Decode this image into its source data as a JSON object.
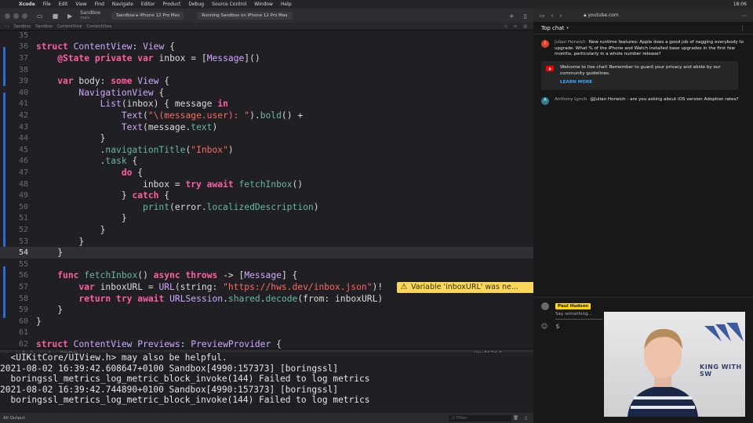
{
  "menubar": {
    "app_name": "Xcode",
    "items": [
      "File",
      "Edit",
      "View",
      "Find",
      "Navigate",
      "Editor",
      "Product",
      "Debug",
      "Source Control",
      "Window",
      "Help"
    ],
    "clock": "18:06"
  },
  "xcode": {
    "scheme_name": "Sandbox",
    "scheme_branch": "main",
    "tab_label": "Sandbox",
    "device": "iPhone 12 Pro Max",
    "status": "Running Sandbox on iPhone 12 Pro Max",
    "jumpbar": [
      "Sandbox",
      "Sandbox",
      "ContentView",
      "ContentView"
    ],
    "warning_text": "Variable 'inboxURL' was ne...",
    "debug_process": "Sandbox",
    "cursor_position": "Line: 54  Col: 6",
    "output_scope": "All Output",
    "filter_placeholder": "Filter",
    "console_lines": [
      "  <UIKitCore/UIView.h> may also be helpful.",
      "2021-08-02 16:39:42.608647+0100 Sandbox[4990:157373] [boringssl]",
      "  boringssl_metrics_log_metric_block_invoke(144) Failed to log metrics",
      "2021-08-02 16:39:42.744890+0100 Sandbox[4990:157373] [boringssl]",
      "  boringssl_metrics_log_metric_block_invoke(144) Failed to log metrics"
    ],
    "code_lines": [
      {
        "n": "35",
        "tokens": []
      },
      {
        "n": "36",
        "tokens": [
          [
            "kw",
            "struct"
          ],
          [
            "p",
            " "
          ],
          [
            "ty",
            "ContentView"
          ],
          [
            "p",
            ": "
          ],
          [
            "ty",
            "View"
          ],
          [
            "p",
            " {"
          ]
        ]
      },
      {
        "n": "37",
        "tokens": [
          [
            "p",
            "    "
          ],
          [
            "kw",
            "@State"
          ],
          [
            "p",
            " "
          ],
          [
            "kw",
            "private"
          ],
          [
            "p",
            " "
          ],
          [
            "kw",
            "var"
          ],
          [
            "p",
            " inbox = ["
          ],
          [
            "ty",
            "Message"
          ],
          [
            "p",
            "]()"
          ]
        ]
      },
      {
        "n": "38",
        "tokens": []
      },
      {
        "n": "39",
        "tokens": [
          [
            "p",
            "    "
          ],
          [
            "kw",
            "var"
          ],
          [
            "p",
            " body: "
          ],
          [
            "kw",
            "some"
          ],
          [
            "p",
            " "
          ],
          [
            "ty",
            "View"
          ],
          [
            "p",
            " {"
          ]
        ]
      },
      {
        "n": "40",
        "tokens": [
          [
            "p",
            "        "
          ],
          [
            "ty",
            "NavigationView"
          ],
          [
            "p",
            " {"
          ]
        ]
      },
      {
        "n": "41",
        "tokens": [
          [
            "p",
            "            "
          ],
          [
            "ty",
            "List"
          ],
          [
            "p",
            "(inbox) { message "
          ],
          [
            "kw",
            "in"
          ]
        ]
      },
      {
        "n": "42",
        "tokens": [
          [
            "p",
            "                "
          ],
          [
            "ty",
            "Text"
          ],
          [
            "p",
            "("
          ],
          [
            "str",
            "\"\\(message.user): \""
          ],
          [
            "p",
            ")."
          ],
          [
            "fn",
            "bold"
          ],
          [
            "p",
            "() +"
          ]
        ]
      },
      {
        "n": "43",
        "tokens": [
          [
            "p",
            "                "
          ],
          [
            "ty",
            "Text"
          ],
          [
            "p",
            "(message."
          ],
          [
            "fn",
            "text"
          ],
          [
            "p",
            ")"
          ]
        ]
      },
      {
        "n": "44",
        "tokens": [
          [
            "p",
            "            }"
          ]
        ]
      },
      {
        "n": "45",
        "tokens": [
          [
            "p",
            "            ."
          ],
          [
            "fn",
            "navigationTitle"
          ],
          [
            "p",
            "("
          ],
          [
            "str",
            "\"Inbox\""
          ],
          [
            "p",
            ")"
          ]
        ]
      },
      {
        "n": "46",
        "tokens": [
          [
            "p",
            "            ."
          ],
          [
            "fn",
            "task"
          ],
          [
            "p",
            " {"
          ]
        ]
      },
      {
        "n": "47",
        "tokens": [
          [
            "p",
            "                "
          ],
          [
            "kw",
            "do"
          ],
          [
            "p",
            " {"
          ]
        ]
      },
      {
        "n": "48",
        "tokens": [
          [
            "p",
            "                    inbox = "
          ],
          [
            "kw",
            "try"
          ],
          [
            "p",
            " "
          ],
          [
            "kw",
            "await"
          ],
          [
            "p",
            " "
          ],
          [
            "fn",
            "fetchInbox"
          ],
          [
            "p",
            "()"
          ]
        ]
      },
      {
        "n": "49",
        "tokens": [
          [
            "p",
            "                } "
          ],
          [
            "kw",
            "catch"
          ],
          [
            "p",
            " {"
          ]
        ]
      },
      {
        "n": "50",
        "tokens": [
          [
            "p",
            "                    "
          ],
          [
            "fn",
            "print"
          ],
          [
            "p",
            "(error."
          ],
          [
            "fn",
            "localizedDescription"
          ],
          [
            "p",
            ")"
          ]
        ]
      },
      {
        "n": "51",
        "tokens": [
          [
            "p",
            "                }"
          ]
        ]
      },
      {
        "n": "52",
        "tokens": [
          [
            "p",
            "            }"
          ]
        ]
      },
      {
        "n": "53",
        "tokens": [
          [
            "p",
            "        }"
          ]
        ]
      },
      {
        "n": "54",
        "tokens": [
          [
            "p",
            "    }"
          ]
        ]
      },
      {
        "n": "55",
        "tokens": []
      },
      {
        "n": "56",
        "tokens": [
          [
            "p",
            "    "
          ],
          [
            "kw",
            "func"
          ],
          [
            "p",
            " "
          ],
          [
            "fn",
            "fetchInbox"
          ],
          [
            "p",
            "() "
          ],
          [
            "kw",
            "async"
          ],
          [
            "p",
            " "
          ],
          [
            "kw",
            "throws"
          ],
          [
            "p",
            " -> ["
          ],
          [
            "ty",
            "Message"
          ],
          [
            "p",
            "] {"
          ]
        ]
      },
      {
        "n": "57",
        "tokens": [
          [
            "p",
            "        "
          ],
          [
            "kw",
            "var"
          ],
          [
            "p",
            " inboxURL = "
          ],
          [
            "ty",
            "URL"
          ],
          [
            "p",
            "(string: "
          ],
          [
            "str",
            "\"https://hws.dev/inbox.json\""
          ],
          [
            "p",
            ")!"
          ]
        ]
      },
      {
        "n": "58",
        "tokens": [
          [
            "p",
            "        "
          ],
          [
            "kw",
            "return"
          ],
          [
            "p",
            " "
          ],
          [
            "kw",
            "try"
          ],
          [
            "p",
            " "
          ],
          [
            "kw",
            "await"
          ],
          [
            "p",
            " "
          ],
          [
            "ty",
            "URLSession"
          ],
          [
            "p",
            "."
          ],
          [
            "fn",
            "shared"
          ],
          [
            "p",
            "."
          ],
          [
            "fn",
            "decode"
          ],
          [
            "p",
            "(from: inboxURL)"
          ]
        ]
      },
      {
        "n": "59",
        "tokens": [
          [
            "p",
            "    }"
          ]
        ]
      },
      {
        "n": "60",
        "tokens": [
          [
            "p",
            "}"
          ]
        ]
      },
      {
        "n": "61",
        "tokens": []
      },
      {
        "n": "62",
        "tokens": [
          [
            "kw",
            "struct"
          ],
          [
            "p",
            " "
          ],
          [
            "ty",
            "ContentView_Previews"
          ],
          [
            "p",
            ": "
          ],
          [
            "ty",
            "PreviewProvider"
          ],
          [
            "p",
            " {"
          ]
        ]
      }
    ]
  },
  "browser": {
    "url": "youtube.com",
    "chat_title": "Top chat",
    "messages": [
      {
        "initial": "J",
        "color": "#e2412c",
        "author": "Julian Horwich",
        "text": "New runtime features: Apple does a good job of nagging everybody to upgrade. What % of the iPhone and Watch installed base upgrades in the first few months, particularly in a whole number release?"
      },
      {
        "initial": "A",
        "color": "#2e7d8a",
        "author": "Anthony Lynch",
        "text": "@Julian Horwich - are you asking about iOS version Adoption rates?"
      }
    ],
    "notice_text": "Welcome to live chat! Remember to guard your privacy and abide by our community guidelines.",
    "notice_link": "LEARN MORE",
    "input_user": "Paul Hudson",
    "input_placeholder": "Say something...",
    "webcam_text": "KING WITH SW"
  }
}
